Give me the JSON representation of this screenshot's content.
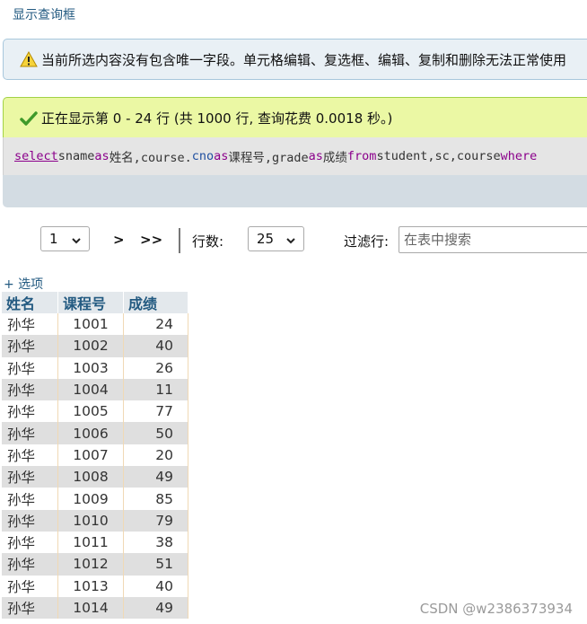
{
  "toggle_link": "显示查询框",
  "notice": {
    "icon": "warning-icon",
    "text": "当前所选内容没有包含唯一字段。单元格编辑、复选框、编辑、复制和删除无法正常使用"
  },
  "success": {
    "icon": "check-icon",
    "text": "正在显示第 0 - 24 行 (共 1000 行, 查询花费 0.0018 秒。)"
  },
  "sql": {
    "kw_select": "select",
    "p1": " sname ",
    "kw_as1": "as",
    "p2": " 姓名,course.",
    "fn_cno": "cno",
    "p3": " ",
    "kw_as2": "as",
    "p4": " 课程号,grade ",
    "kw_as3": "as",
    "p5": " 成绩 ",
    "kw_from": "from",
    "p6": " student,sc,course ",
    "kw_where": "where"
  },
  "navigation": {
    "page_select": "1",
    "next": ">",
    "last": ">>",
    "rows_label": "行数:",
    "rows_select": "25",
    "filter_label": "过滤行:",
    "filter_placeholder": "在表中搜索"
  },
  "options_link": "+ 选项",
  "table": {
    "columns": [
      "姓名",
      "课程号",
      "成绩"
    ],
    "rows": [
      [
        "孙华",
        "1001",
        "24"
      ],
      [
        "孙华",
        "1002",
        "40"
      ],
      [
        "孙华",
        "1003",
        "26"
      ],
      [
        "孙华",
        "1004",
        "11"
      ],
      [
        "孙华",
        "1005",
        "77"
      ],
      [
        "孙华",
        "1006",
        "50"
      ],
      [
        "孙华",
        "1007",
        "20"
      ],
      [
        "孙华",
        "1008",
        "49"
      ],
      [
        "孙华",
        "1009",
        "85"
      ],
      [
        "孙华",
        "1010",
        "79"
      ],
      [
        "孙华",
        "1011",
        "38"
      ],
      [
        "孙华",
        "1012",
        "51"
      ],
      [
        "孙华",
        "1013",
        "40"
      ],
      [
        "孙华",
        "1014",
        "49"
      ]
    ]
  },
  "watermark": "CSDN @w2386373934",
  "colors": {
    "link": "#235a81",
    "notice_bg": "#e9f0f5",
    "success_bg": "#ebf8a4",
    "sql_bg": "#e5e5e5",
    "sql_bar": "#d3dce3",
    "keyword": "#8b008b",
    "header_bg": "#e3e8ec",
    "even_row": "#dfdfdf"
  }
}
